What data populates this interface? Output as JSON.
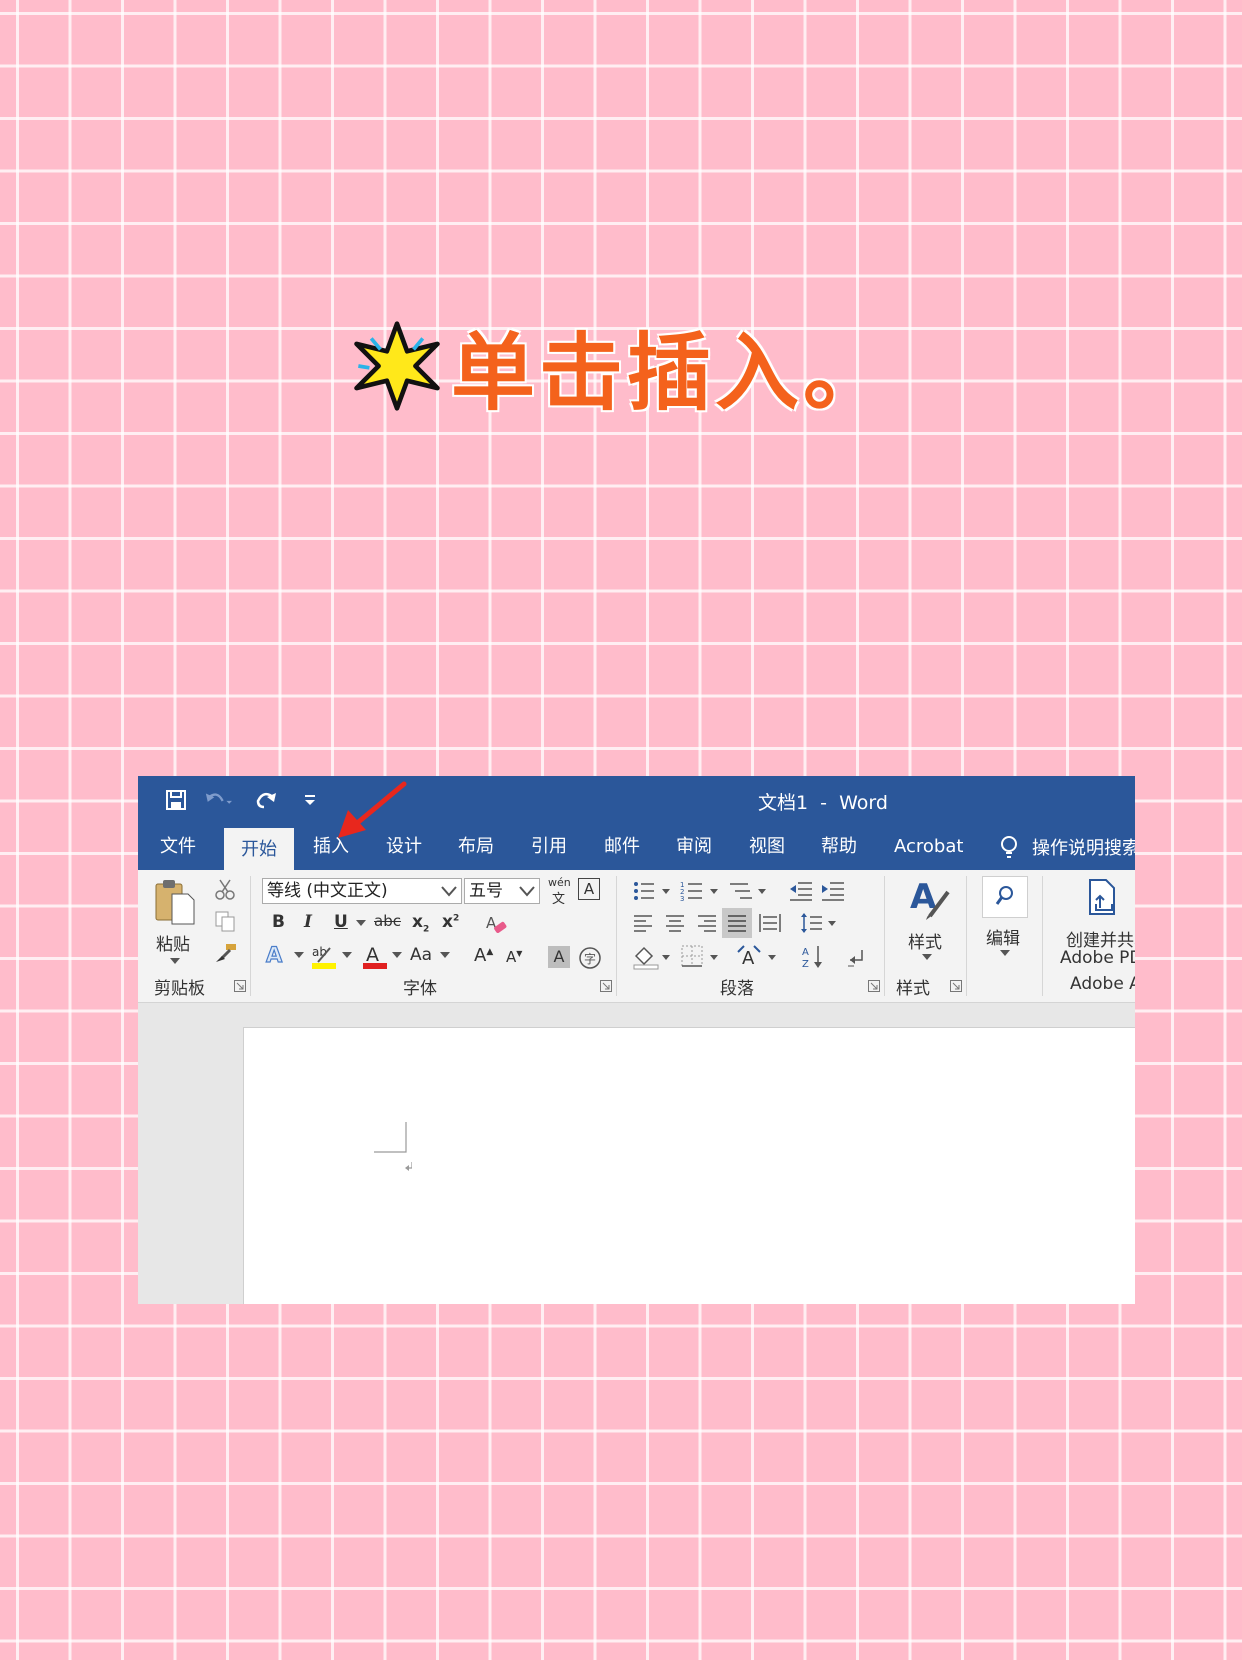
{
  "heading": {
    "text": "单击插入。",
    "star_icon": "sparkle-star-icon"
  },
  "titlebar": {
    "doc_title": "文档1  -  Word",
    "icons": [
      "save-icon",
      "undo-icon",
      "redo-icon",
      "customize-qat-icon"
    ]
  },
  "tabs": [
    {
      "label": "文件"
    },
    {
      "label": "开始"
    },
    {
      "label": "插入"
    },
    {
      "label": "设计"
    },
    {
      "label": "布局"
    },
    {
      "label": "引用"
    },
    {
      "label": "邮件"
    },
    {
      "label": "审阅"
    },
    {
      "label": "视图"
    },
    {
      "label": "帮助"
    },
    {
      "label": "Acrobat"
    }
  ],
  "tell_me": {
    "label": "操作说明搜索"
  },
  "ribbon": {
    "clipboard": {
      "paste_label": "粘贴",
      "group_label": "剪贴板"
    },
    "font": {
      "font_name": "等线 (中文正文)",
      "font_size": "五号",
      "wen_label": "wén",
      "wen_sub": "文",
      "bold": "B",
      "italic": "I",
      "underline": "U",
      "strike": "abc",
      "subscript": "x",
      "superscript": "x",
      "change_case": "Aa",
      "grow": "A",
      "shrink": "A",
      "group_label": "字体"
    },
    "paragraph": {
      "group_label": "段落"
    },
    "styles": {
      "label": "样式",
      "group_label": "样式"
    },
    "editing": {
      "label": "编辑"
    },
    "adobe": {
      "label_line1": "创建并共享",
      "label_line2": "Adobe PDF",
      "group_label": "Adobe Acrobat"
    }
  },
  "colors": {
    "word_blue": "#2b579a",
    "heading_orange": "#f4621c",
    "arrow_red": "#e8271d"
  }
}
